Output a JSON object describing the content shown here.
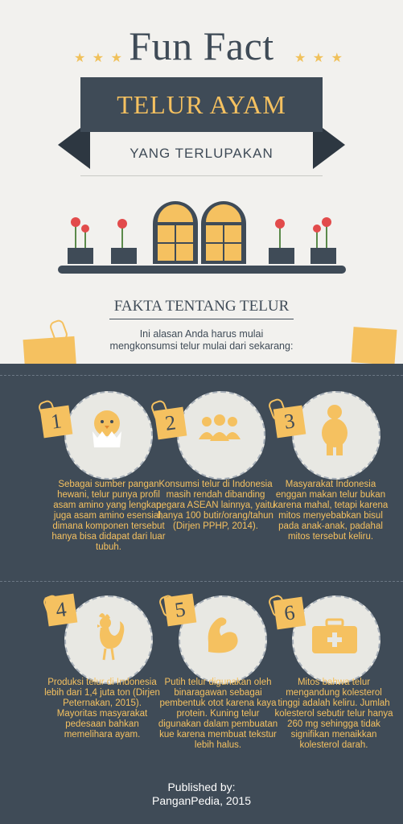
{
  "header": {
    "title": "Fun Fact",
    "banner": "TELUR AYAM",
    "subtitle": "YANG TERLUPAKAN"
  },
  "section": {
    "heading": "FAKTA TENTANG TELUR",
    "intro": "Ini alasan Anda harus mulai mengkonsumsi telur mulai dari sekarang:"
  },
  "facts": [
    {
      "num": "1",
      "icon": "chick-icon",
      "text": "Sebagai sumber pangan hewani, telur punya profil asam amino yang lengkap, juga asam amino esensial, dimana komponen tersebut hanya bisa didapat dari luar tubuh."
    },
    {
      "num": "2",
      "icon": "people-icon",
      "text": "Konsumsi telur di Indonesia masih rendah dibanding negara ASEAN lainnya, yaitu hanya 100 butir/orang/tahun (Dirjen PPHP, 2014)."
    },
    {
      "num": "3",
      "icon": "person-icon",
      "text": "Masyarakat Indonesia enggan makan telur bukan karena mahal, tetapi karena mitos menyebabkan bisul pada anak-anak, padahal mitos tersebut keliru."
    },
    {
      "num": "4",
      "icon": "rooster-icon",
      "text": "Produksi telur di Indonesia lebih dari 1,4 juta ton (Dirjen Peternakan, 2015). Mayoritas masyarakat pedesaan bahkan memelihara ayam."
    },
    {
      "num": "5",
      "icon": "muscle-arm-icon",
      "text": "Putih telur digunakan oleh binaragawan sebagai pembentuk otot karena kaya protein. Kuning telur digunakan dalam pembuatan kue karena membuat tekstur lebih halus."
    },
    {
      "num": "6",
      "icon": "medical-kit-icon",
      "text": "Mitos bahwa telur mengandung kolesterol tinggi adalah keliru. Jumlah kolesterol sebutir telur hanya 260 mg sehingga tidak signifikan menaikkan kolesterol darah."
    }
  ],
  "footer": {
    "line1": "Published by:",
    "line2": "PanganPedia, 2015"
  },
  "colors": {
    "dark": "#3f4b57",
    "accent": "#f5c160",
    "light": "#f2f1ee",
    "flower": "#e24b4b"
  }
}
